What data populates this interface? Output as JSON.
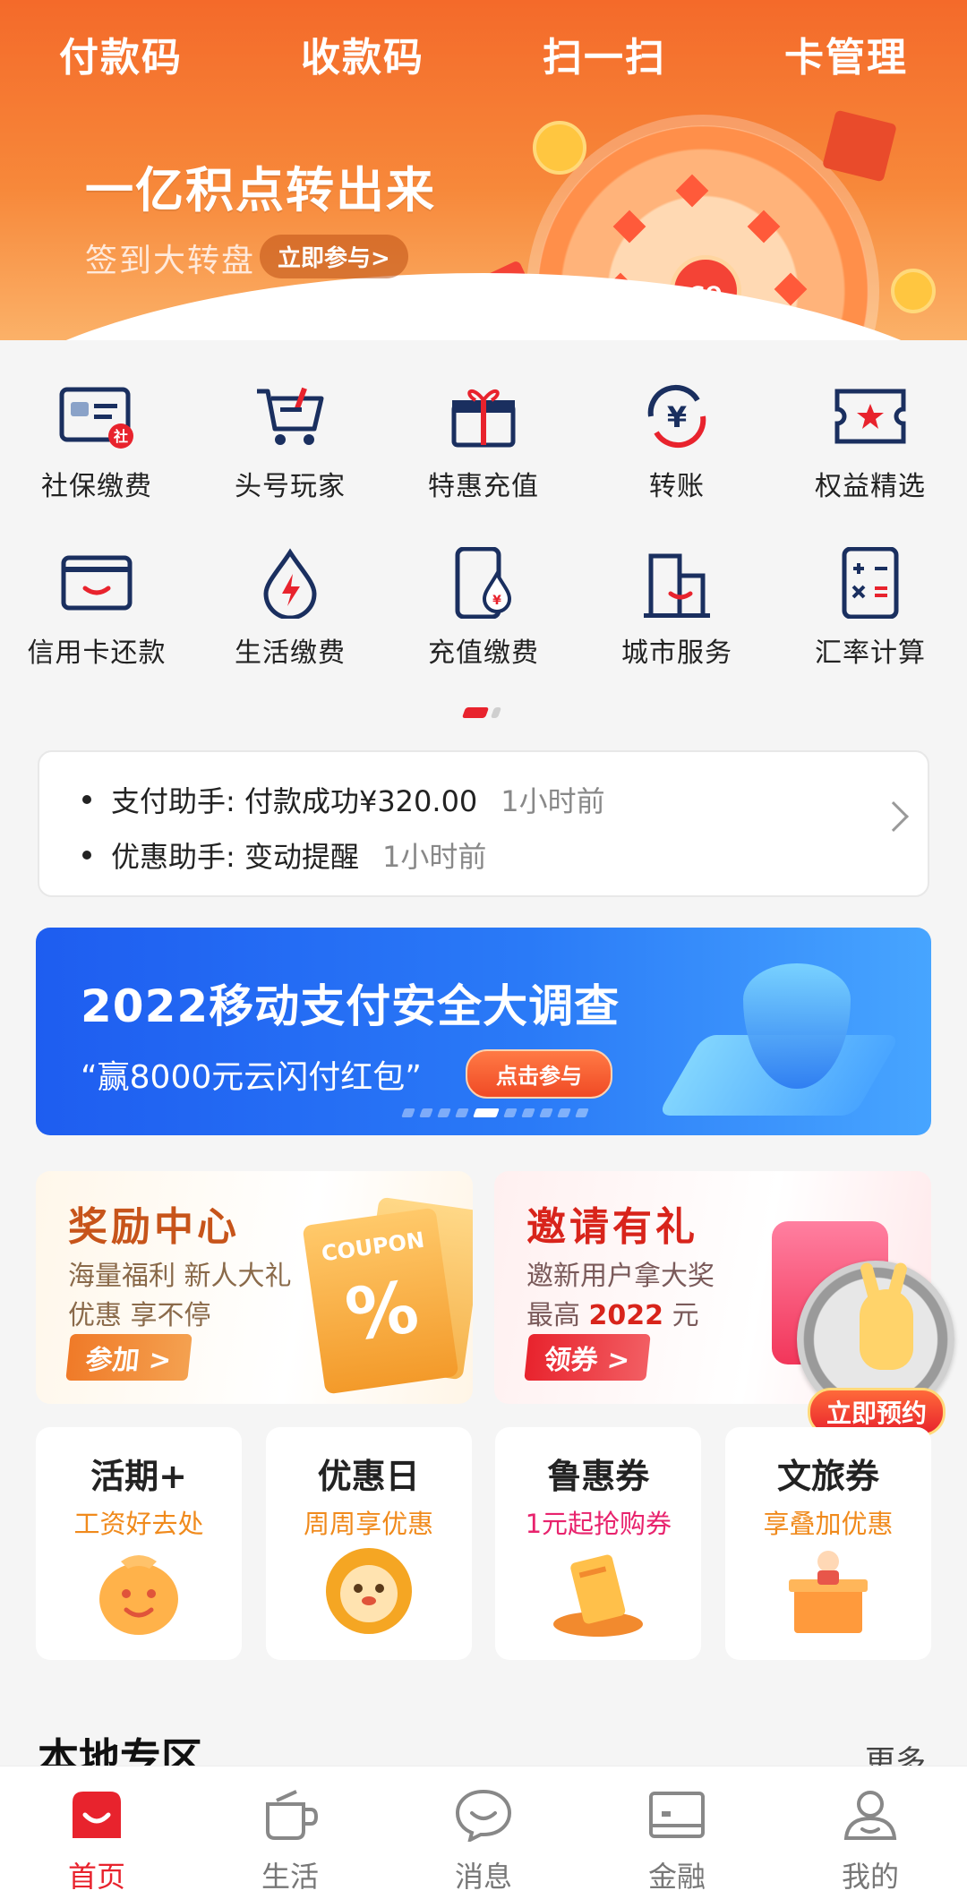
{
  "header": {
    "actions": [
      "付款码",
      "收款码",
      "扫一扫",
      "卡管理"
    ],
    "promo_title": "一亿积点转出来",
    "promo_subtitle": "签到大转盘",
    "promo_button": "立即参与>",
    "wheel_label": "GO"
  },
  "grid": {
    "row1": [
      {
        "label": "社保缴费",
        "icon": "social-security-card-icon"
      },
      {
        "label": "头号玩家",
        "icon": "shopping-cart-icon"
      },
      {
        "label": "特惠充值",
        "icon": "gift-icon"
      },
      {
        "label": "转账",
        "icon": "yuan-transfer-icon"
      },
      {
        "label": "权益精选",
        "icon": "ticket-star-icon"
      }
    ],
    "row2": [
      {
        "label": "信用卡还款",
        "icon": "credit-card-icon"
      },
      {
        "label": "生活缴费",
        "icon": "utility-drop-icon"
      },
      {
        "label": "充值缴费",
        "icon": "phone-recharge-icon"
      },
      {
        "label": "城市服务",
        "icon": "city-building-icon"
      },
      {
        "label": "汇率计算",
        "icon": "calculator-icon"
      }
    ],
    "badge": "社"
  },
  "notifications": [
    {
      "text": "支付助手: 付款成功¥320.00",
      "time": "1小时前"
    },
    {
      "text": "优惠助手: 变动提醒",
      "time": "1小时前"
    }
  ],
  "banner": {
    "title": "2022移动支付安全大调查",
    "subtitle": "“赢8000元云闪付红包”",
    "button": "点击参与"
  },
  "reward_card": {
    "title": "奖励中心",
    "line1": "海量福利 新人大礼",
    "line2": "优惠 享不停",
    "button": "参加 >",
    "coupon_text": "COUPON",
    "coupon_symbol": "%"
  },
  "invite_card": {
    "title": "邀请有礼",
    "line1": "邀新用户拿大奖",
    "line2_prefix": "最高",
    "line2_value": "2022",
    "line2_suffix": "元",
    "button": "领券 >"
  },
  "reserve_label": "立即预约",
  "small_cards": [
    {
      "title": "活期+",
      "subtitle": "工资好去处",
      "color": "#f08a1c"
    },
    {
      "title": "优惠日",
      "subtitle": "周周享优惠",
      "color": "#f08a1c"
    },
    {
      "title": "鲁惠券",
      "subtitle": "1元起抢购券",
      "color": "#e8236d"
    },
    {
      "title": "文旅券",
      "subtitle": "享叠加优惠",
      "color": "#f08a1c"
    }
  ],
  "local_section": {
    "title": "本地专区",
    "more": "更多"
  },
  "bottom_nav": [
    {
      "label": "首页",
      "icon": "home-smile-icon",
      "active": true
    },
    {
      "label": "生活",
      "icon": "cup-icon",
      "active": false
    },
    {
      "label": "消息",
      "icon": "chat-bubble-icon",
      "active": false
    },
    {
      "label": "金融",
      "icon": "wallet-card-icon",
      "active": false
    },
    {
      "label": "我的",
      "icon": "user-profile-icon",
      "active": false
    }
  ],
  "colors": {
    "brand_red": "#e8232d",
    "header_orange": "#f46a2a",
    "banner_blue": "#1e5df0",
    "icon_navy": "#1a2f5f"
  }
}
